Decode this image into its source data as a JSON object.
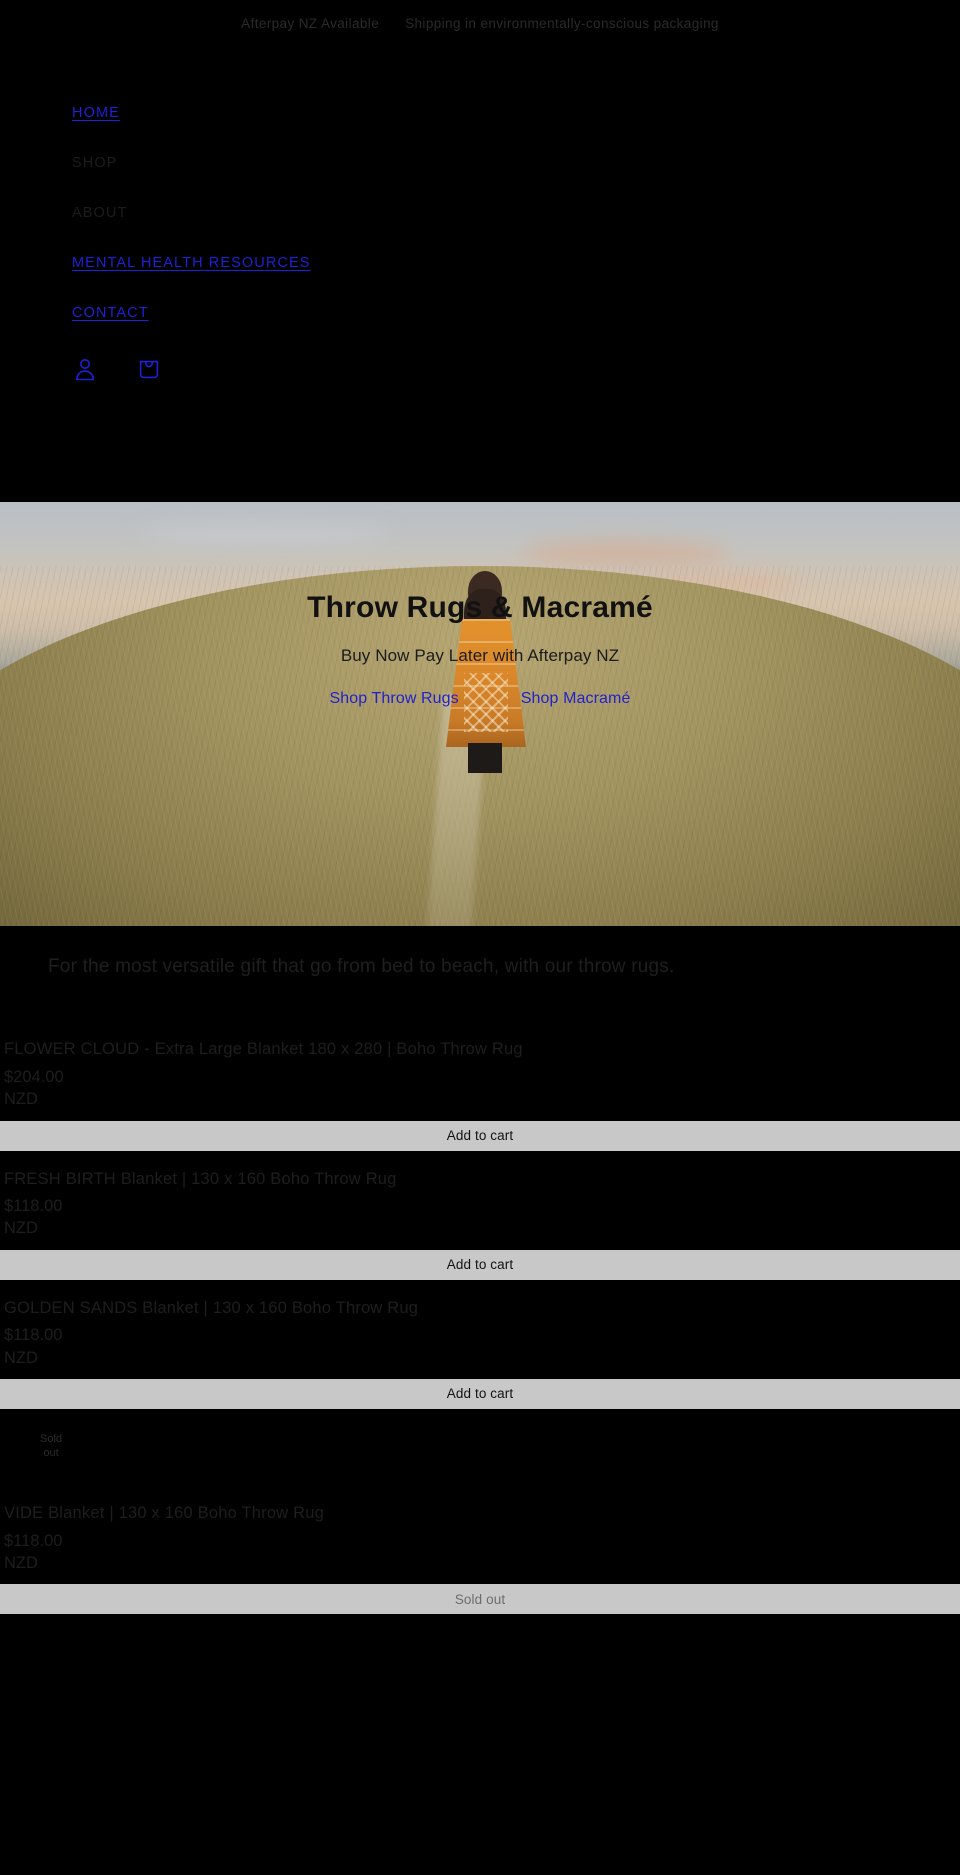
{
  "announcement": {
    "items": [
      "Afterpay NZ Available",
      "Shipping in environmentally-conscious packaging"
    ]
  },
  "nav": {
    "items": [
      {
        "label": "HOME",
        "style": "linked"
      },
      {
        "label": "SHOP",
        "style": "dim"
      },
      {
        "label": "ABOUT",
        "style": "dim"
      },
      {
        "label": "MENTAL HEALTH RESOURCES",
        "style": "linked"
      },
      {
        "label": "CONTACT",
        "style": "linked"
      }
    ],
    "account_icon": "account-person-icon",
    "cart_icon": "shopping-bag-icon"
  },
  "hero": {
    "title": "Throw Rugs & Macramé",
    "subtitle": "Buy Now Pay Later with Afterpay NZ",
    "buttons": [
      {
        "label": "Shop Throw Rugs"
      },
      {
        "label": "Shop Macramé"
      }
    ]
  },
  "richtext": {
    "paragraph": "For the most versatile gift that go from bed to beach, with our throw rugs."
  },
  "products": [
    {
      "title": "FLOWER CLOUD - Extra Large Blanket 180 x 280 | Boho Throw Rug",
      "price": "$204.00",
      "currency": "NZD",
      "cta": "Add to cart",
      "sold_out": false,
      "badge": ""
    },
    {
      "title": "FRESH BIRTH Blanket | 130 x 160 Boho Throw Rug",
      "price": "$118.00",
      "currency": "NZD",
      "cta": "Add to cart",
      "sold_out": false,
      "badge": ""
    },
    {
      "title": "GOLDEN SANDS Blanket | 130 x 160 Boho Throw Rug",
      "price": "$118.00",
      "currency": "NZD",
      "cta": "Add to cart",
      "sold_out": false,
      "badge": ""
    },
    {
      "title": "VIDE Blanket | 130 x 160 Boho Throw Rug",
      "price": "$118.00",
      "currency": "NZD",
      "cta": "Sold out",
      "sold_out": true,
      "badge": "Sold out"
    }
  ],
  "colors": {
    "background": "#000000",
    "link": "#2020d8",
    "hero_button": "#2222cc",
    "button_bg": "#c8c8c8",
    "muted_text": "#1e1e1e"
  }
}
